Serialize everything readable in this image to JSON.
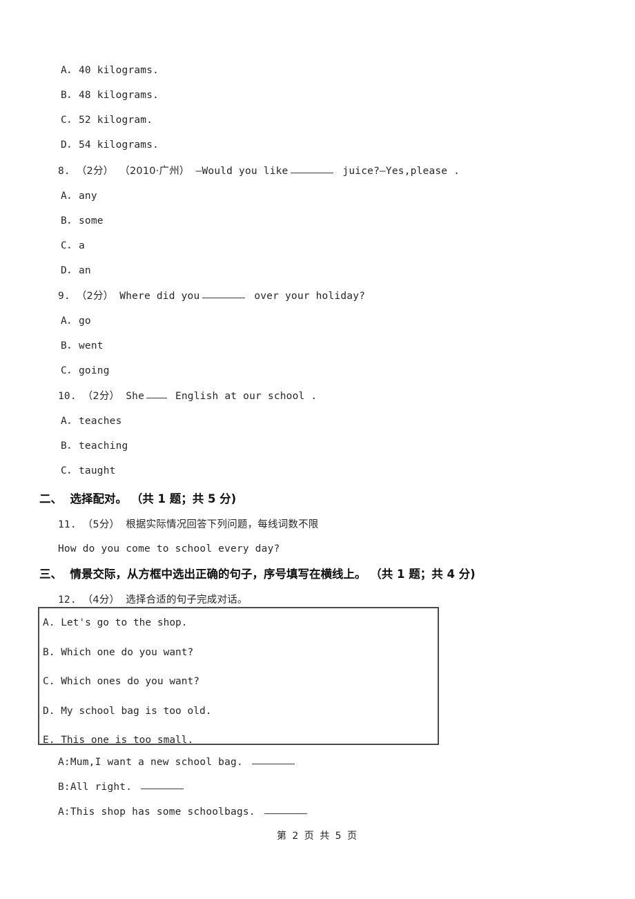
{
  "page": {
    "footer": "第 2 页 共 5 页"
  },
  "q7_options": [
    {
      "label": "A．",
      "text": "40 kilograms."
    },
    {
      "label": "B．",
      "text": "48 kilograms."
    },
    {
      "label": "C．",
      "text": "52 kilogram."
    },
    {
      "label": "D．",
      "text": "54 kilograms."
    }
  ],
  "q8": {
    "number": "8.",
    "score": "（2分）",
    "source": "（2010·广州）",
    "stem_before": "—Would you like",
    "stem_after": "juice?—Yes,please .",
    "options": [
      {
        "label": "A．",
        "text": "any"
      },
      {
        "label": "B．",
        "text": "some"
      },
      {
        "label": "C．",
        "text": "a"
      },
      {
        "label": "D．",
        "text": "an"
      }
    ]
  },
  "q9": {
    "number": "9.",
    "score": "（2分）",
    "stem_before": "Where did you",
    "stem_after": "over your holiday?",
    "options": [
      {
        "label": "A．",
        "text": "go"
      },
      {
        "label": "B．",
        "text": "went"
      },
      {
        "label": "C．",
        "text": "going"
      }
    ]
  },
  "q10": {
    "number": "10.",
    "score": "（2分）",
    "stem_before": "She",
    "stem_after": "English at our school .",
    "options": [
      {
        "label": "A．",
        "text": "teaches"
      },
      {
        "label": "B．",
        "text": "teaching"
      },
      {
        "label": "C．",
        "text": "taught"
      }
    ]
  },
  "section2": {
    "heading": "二、  选择配对。 （共 1 题；共 5 分)",
    "q11": {
      "number": "11.",
      "score": "（5分）",
      "instruction": "根据实际情况回答下列问题，每线词数不限",
      "prompt": "How do you come to school every day?"
    }
  },
  "section3": {
    "heading": "三、  情景交际，从方框中选出正确的句子，序号填写在横线上。 （共 1 题；共 4 分)",
    "q12": {
      "number": "12.",
      "score": "（4分）",
      "instruction": "选择合适的句子完成对话。",
      "choice_box": [
        "A. Let's go to the shop.",
        "B. Which one do you want?",
        "C. Which ones do you want?",
        "D. My school bag is too old.",
        "E. This one is too small."
      ],
      "dialogue": [
        "A:Mum,I want a new school bag.",
        "B:All right.",
        "A:This shop has some schoolbags."
      ]
    }
  }
}
